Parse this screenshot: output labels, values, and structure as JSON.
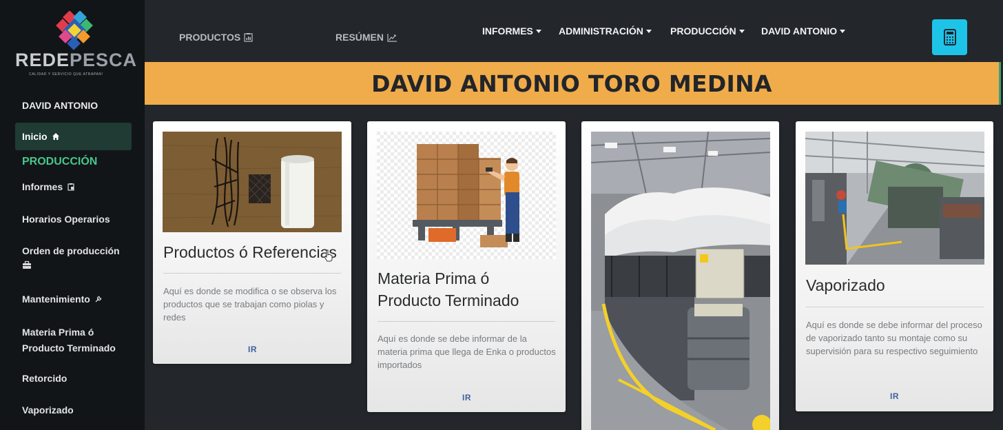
{
  "brand": {
    "name_part1": "REDE",
    "name_part2": "PESCA",
    "tagline": "CALIDAD Y SERVICIO QUE ATRAPAN!"
  },
  "sidebar": {
    "user": "DAVID ANTONIO",
    "active_item": "Inicio",
    "section": "PRODUCCIÓN",
    "items": [
      {
        "label": "Informes"
      },
      {
        "label": "Horarios Operarios"
      },
      {
        "label": "Orden de producción"
      },
      {
        "label": "Mantenimiento"
      },
      {
        "label": "Materia Prima ó Producto Terminado"
      },
      {
        "label": "Retorcido"
      },
      {
        "label": "Vaporizado"
      }
    ]
  },
  "topnav": {
    "link_productos": "PRODUCTOS",
    "link_resumen": "RESÚMEN",
    "dropdowns": [
      "INFORMES",
      "ADMINISTRACIÓN",
      "PRODUCCIÓN",
      "DAVID ANTONIO"
    ]
  },
  "banner": {
    "title": "DAVID ANTONIO TORO MEDINA"
  },
  "cards": [
    {
      "title": "Productos ó Referencias",
      "text": "Aquí es donde se modifica o se observa los productos que se trabajan como piolas y redes",
      "link": "IR"
    },
    {
      "title": "Materia Prima ó Producto Terminado",
      "text": "Aquí es donde se debe informar de la materia prima que llega de Enka o productos importados",
      "link": "IR"
    },
    {
      "title": "",
      "text": "",
      "link": ""
    },
    {
      "title": "Vaporizado",
      "text": "Aquí es donde se debe informar del proceso de vaporizado tanto su montaje como su supervisión para su respectivo seguimiento",
      "link": "IR"
    }
  ],
  "colors": {
    "sidebar_bg": "#121518",
    "page_bg": "#23262b",
    "banner": "#f0ac4a",
    "active_item": "#1f3b34",
    "section_green": "#48c78e",
    "calc_button": "#1ec4e8",
    "link_blue": "#3e5f9e"
  },
  "icons": [
    "home-icon",
    "clipboard-icon",
    "toolbox-icon",
    "wrench-icon",
    "chart-icon",
    "trend-icon",
    "calculator-icon"
  ]
}
